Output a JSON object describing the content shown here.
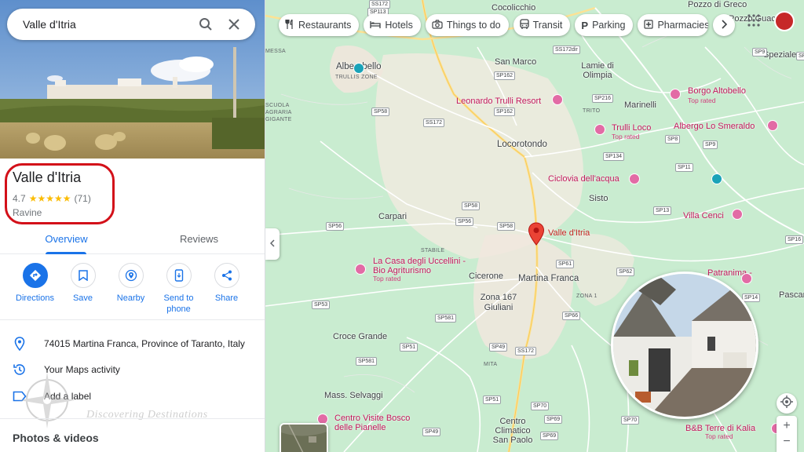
{
  "search": {
    "value": "Valle d'Itria"
  },
  "place": {
    "name": "Valle d'Itria",
    "rating": "4.7",
    "stars": "★★★★★",
    "reviews_count": "(71)",
    "type": "Ravine"
  },
  "tabs": [
    {
      "label": "Overview"
    },
    {
      "label": "Reviews"
    }
  ],
  "actions": [
    {
      "label": "Directions",
      "icon": "directions-icon"
    },
    {
      "label": "Save",
      "icon": "bookmark-icon"
    },
    {
      "label": "Nearby",
      "icon": "nearby-icon"
    },
    {
      "label": "Send to phone",
      "icon": "phone-icon"
    },
    {
      "label": "Share",
      "icon": "share-icon"
    }
  ],
  "info": {
    "address": "74015 Martina Franca, Province of Taranto, Italy",
    "activity": "Your Maps activity",
    "label": "Add a label"
  },
  "photos_heading": "Photos & videos",
  "watermark": "Discovering Destinations",
  "chips": [
    {
      "label": "Restaurants",
      "icon": "fork-knife-icon"
    },
    {
      "label": "Hotels",
      "icon": "bed-icon"
    },
    {
      "label": "Things to do",
      "icon": "camera-icon"
    },
    {
      "label": "Transit",
      "icon": "bus-icon"
    },
    {
      "label": "Parking",
      "icon": "parking-icon"
    },
    {
      "label": "Pharmacies",
      "icon": "pharmacy-icon"
    }
  ],
  "map": {
    "selected_label": "Valle d'Itria",
    "towns": {
      "cocolicchio": "Cocolicchio",
      "pozzo_faceto": "Pozzo di Greco",
      "pozzo_guacito": "Pozzo Guacito",
      "alberobello": "Alberobello",
      "san_marco": "San Marco",
      "lamie": "Lamie di Olimpia",
      "speziale": "Speziale",
      "marinelli": "Marinelli",
      "locorotondo": "Locorotondo",
      "sisto": "Sisto",
      "carpari": "Carpari",
      "cicerone": "Cicerone",
      "martina_franca": "Martina Franca",
      "zona167": "Zona 167 Giuliani",
      "croce_grande": "Croce Grande",
      "mass_selvaggi": "Mass. Selvaggi",
      "centro_climatico": "Centro Climatico San Paolo",
      "pascar": "Pascar"
    },
    "small_labels": {
      "trullis_zone": "TRULLIS ZONE",
      "scuola": "SCUOLA AGRARIA GIGANTE",
      "trito": "TRITO",
      "stabile": "STABILE",
      "zona1": "ZONA 1",
      "mita": "MITA",
      "messa": "MESSA"
    },
    "pois": {
      "trulli_resort": "Leonardo Trulli Resort",
      "borgo": "Borgo Altobello",
      "borgo_sub": "Top rated",
      "trulli_loco": "Trulli Loco",
      "trulli_loco_sub": "Top rated",
      "albergo": "Albergo Lo Smeraldo",
      "ciclovia": "Ciclovia dell'acqua",
      "villa_cenci": "Villa Cenci",
      "uccellini": "La Casa degli Uccellini - Bio Agriturismo",
      "uccellini_sub": "Top rated",
      "patranima": "Patranima -",
      "centro_visite": "Centro Visite Bosco delle Pianelle",
      "bb_kalia": "B&B Terre di Kalia",
      "bb_kalia_sub": "Top rated"
    },
    "roads": [
      "SS172",
      "SP113",
      "SS172dir",
      "SP162",
      "SP58",
      "SS172",
      "SP162",
      "SP216",
      "SP134",
      "SP8",
      "SP9",
      "SP11",
      "SP13",
      "SP58",
      "SP56",
      "SP56",
      "SP58",
      "SP61",
      "SP62",
      "SP53",
      "SP581",
      "SP66",
      "SP14",
      "SP51",
      "SP49",
      "SP581",
      "SS172",
      "SP51",
      "SP70",
      "SP69",
      "SP70",
      "SP69",
      "SP49",
      "SP16",
      "SP9",
      "SP5"
    ]
  },
  "colors": {
    "accent": "#1a73e8",
    "highlight": "#d31019",
    "poi": "#c2185b",
    "pin": "#ea4335"
  }
}
